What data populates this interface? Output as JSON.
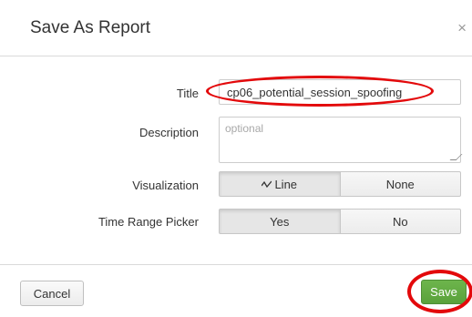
{
  "dialog": {
    "title": "Save As Report",
    "close_glyph": "×"
  },
  "form": {
    "title_label": "Title",
    "title_value": "cp06_potential_session_spoofing",
    "description_label": "Description",
    "description_placeholder": "optional",
    "visualization_label": "Visualization",
    "visualization_options": [
      "Line",
      "None"
    ],
    "visualization_selected": "Line",
    "visualization_line_icon": "line-chart-icon",
    "time_range_picker_label": "Time Range Picker",
    "time_range_picker_options": [
      "Yes",
      "No"
    ],
    "time_range_picker_selected": "Yes"
  },
  "footer": {
    "cancel_label": "Cancel",
    "save_label": "Save",
    "save_color": "#5ca83e"
  },
  "annotations": {
    "highlight_color": "#e3090b",
    "highlighted": [
      "title-input",
      "save-button"
    ]
  }
}
